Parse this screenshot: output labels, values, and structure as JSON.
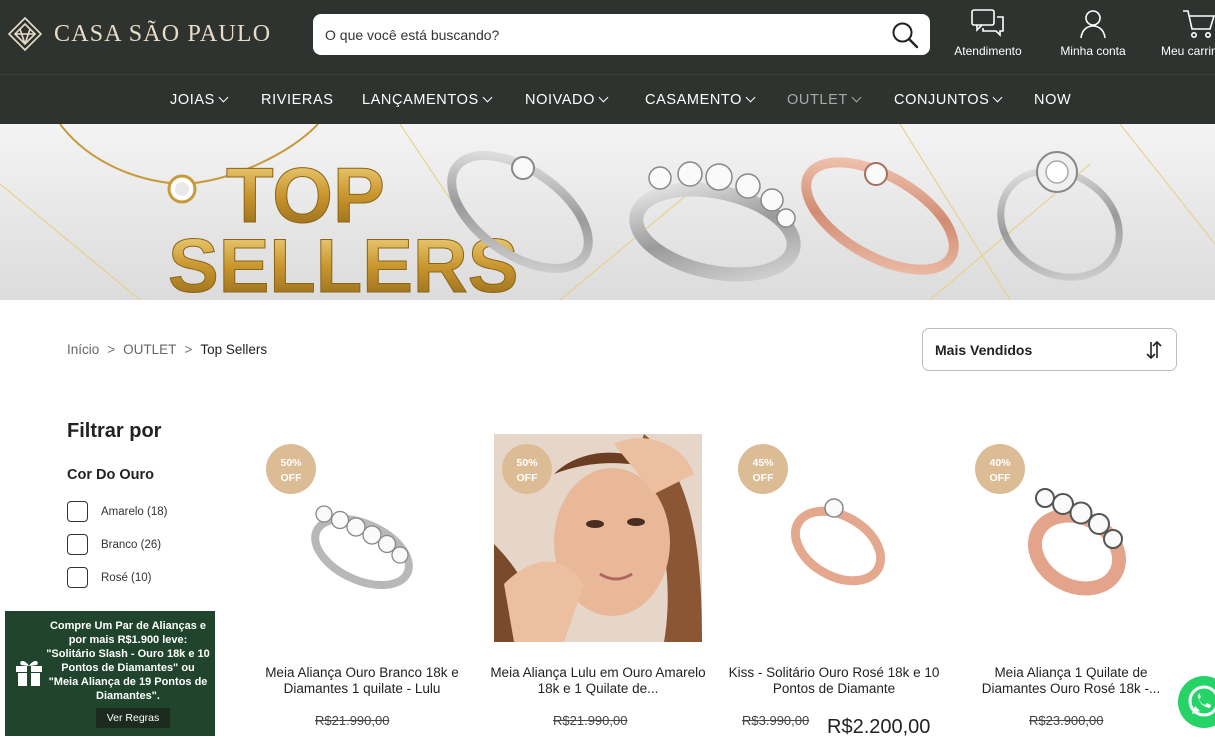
{
  "brand": {
    "name": "CASA SÃO PAULO"
  },
  "search": {
    "placeholder": "O que você está buscando?"
  },
  "header_actions": {
    "atendimento": "Atendimento",
    "minha_conta": "Minha conta",
    "carrinho": "Meu carrinho"
  },
  "nav": {
    "items": [
      {
        "label": "JOIAS",
        "dropdown": true
      },
      {
        "label": "RIVIERAS",
        "dropdown": false
      },
      {
        "label": "LANÇAMENTOS",
        "dropdown": true
      },
      {
        "label": "NOIVADO",
        "dropdown": true
      },
      {
        "label": "CASAMENTO",
        "dropdown": true
      },
      {
        "label": "OUTLET",
        "dropdown": true,
        "active": true
      },
      {
        "label": "CONJUNTOS",
        "dropdown": true
      },
      {
        "label": "NOW",
        "dropdown": false
      }
    ]
  },
  "banner": {
    "line1": "TOP",
    "line2": "SELLERS"
  },
  "breadcrumb": {
    "items": [
      "Início",
      "OUTLET",
      "Top Sellers"
    ],
    "separator": ">"
  },
  "sort": {
    "selected": "Mais Vendidos"
  },
  "filters": {
    "title": "Filtrar por",
    "group_title": "Cor Do Ouro",
    "options": [
      {
        "label": "Amarelo (18)",
        "checked": false
      },
      {
        "label": "Branco (26)",
        "checked": false
      },
      {
        "label": "Rosé (10)",
        "checked": false
      }
    ]
  },
  "products": [
    {
      "badge_pct": "50%",
      "badge_off": "OFF",
      "name": "Meia Aliança Ouro Branco 18k e Diamantes 1 quilate - Lulu",
      "price_old": "R$21.990,00",
      "price_new": ""
    },
    {
      "badge_pct": "50%",
      "badge_off": "OFF",
      "name": "Meia Aliança Lulu em Ouro Amarelo 18k e 1 Quilate de...",
      "price_old": "R$21.990,00",
      "price_new": ""
    },
    {
      "badge_pct": "45%",
      "badge_off": "OFF",
      "name": "Kiss - Solitário Ouro Rosé 18k e 10 Pontos de Diamante",
      "price_old": "R$3.990,00",
      "price_new": "R$2.200,00"
    },
    {
      "badge_pct": "40%",
      "badge_off": "OFF",
      "name": "Meia Aliança 1 Quilate de Diamantes Ouro Rosé 18k -...",
      "price_old": "R$23.900,00",
      "price_new": ""
    }
  ],
  "promo": {
    "text": "Compre Um Par de Alianças e por mais R$1.900 leve: \"Solitário Slash - Ouro 18k e 10 Pontos de Diamantes\" ou \"Meia Aliança de 19 Pontos de Diamantes\".",
    "button": "Ver Regras"
  },
  "colors": {
    "header_bg": "#2e3330",
    "badge": "#dcbc95",
    "promo_bg": "#20452c",
    "logo": "#e9dcc7",
    "whatsapp": "#25d366"
  }
}
